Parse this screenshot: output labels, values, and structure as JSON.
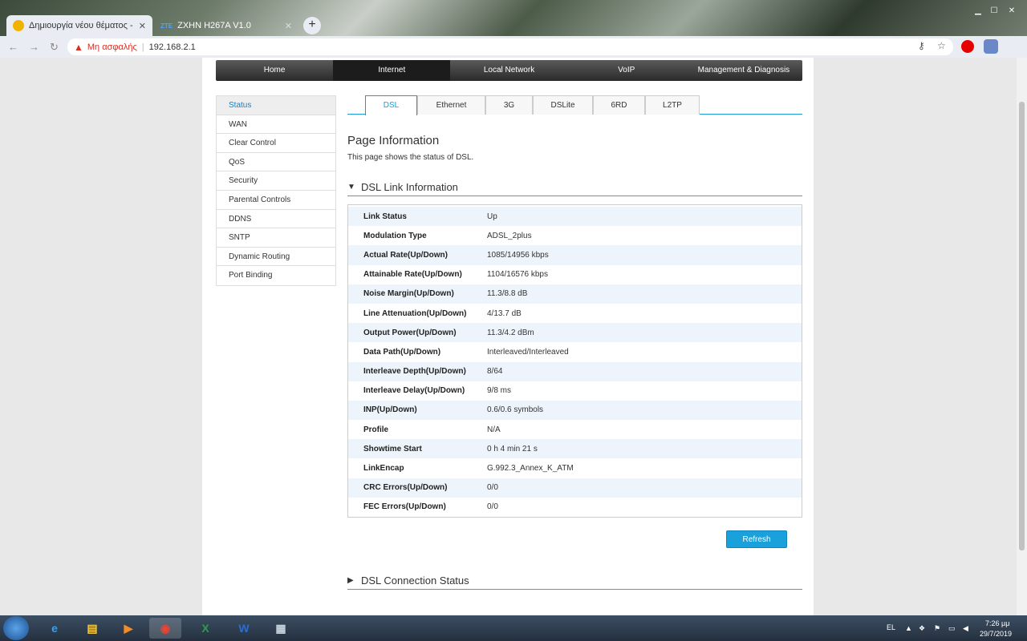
{
  "browser": {
    "tabs": [
      {
        "title": "Δημιουργία νέου θέματος - Inso",
        "active": true,
        "favicon": "forum-favicon"
      },
      {
        "title": "ZXHN H267A V1.0",
        "active": false,
        "favicon": "zte-favicon",
        "favicon_text": "ZTE"
      }
    ],
    "new_tab": "+",
    "security_label": "Μη ασφαλής",
    "url": "192.168.2.1",
    "url_separator": "|"
  },
  "topnav": {
    "items": [
      "Home",
      "Internet",
      "Local Network",
      "VoIP",
      "Management & Diagnosis"
    ],
    "active": "Internet"
  },
  "sidebar": {
    "items": [
      "Status",
      "WAN",
      "Clear Control",
      "QoS",
      "Security",
      "Parental Controls",
      "DDNS",
      "SNTP",
      "Dynamic Routing",
      "Port Binding"
    ],
    "active": "Status"
  },
  "subtabs": {
    "items": [
      "DSL",
      "Ethernet",
      "3G",
      "DSLite",
      "6RD",
      "L2TP"
    ],
    "active": "DSL"
  },
  "page": {
    "title": "Page Information",
    "description": "This page shows the status of DSL."
  },
  "dsl_link": {
    "heading": "DSL Link Information",
    "expanded": true,
    "rows": [
      {
        "label": "Link Status",
        "value": "Up"
      },
      {
        "label": "Modulation Type",
        "value": "ADSL_2plus"
      },
      {
        "label": "Actual Rate(Up/Down)",
        "value": "1085/14956 kbps"
      },
      {
        "label": "Attainable Rate(Up/Down)",
        "value": "1104/16576 kbps"
      },
      {
        "label": "Noise Margin(Up/Down)",
        "value": "11.3/8.8 dB"
      },
      {
        "label": "Line Attenuation(Up/Down)",
        "value": "4/13.7 dB"
      },
      {
        "label": "Output Power(Up/Down)",
        "value": "11.3/4.2 dBm"
      },
      {
        "label": "Data Path(Up/Down)",
        "value": "Interleaved/Interleaved"
      },
      {
        "label": "Interleave Depth(Up/Down)",
        "value": "8/64"
      },
      {
        "label": "Interleave Delay(Up/Down)",
        "value": "9/8 ms"
      },
      {
        "label": "INP(Up/Down)",
        "value": "0.6/0.6 symbols"
      },
      {
        "label": "Profile",
        "value": "N/A"
      },
      {
        "label": "Showtime Start",
        "value": "0 h 4 min 21 s"
      },
      {
        "label": "LinkEncap",
        "value": "G.992.3_Annex_K_ATM"
      },
      {
        "label": "CRC Errors(Up/Down)",
        "value": "0/0"
      },
      {
        "label": "FEC Errors(Up/Down)",
        "value": "0/0"
      }
    ],
    "refresh_label": "Refresh"
  },
  "dsl_connection": {
    "heading": "DSL Connection Status",
    "expanded": false
  },
  "taskbar": {
    "apps": [
      "internet-explorer-icon",
      "file-explorer-icon",
      "media-player-icon",
      "chrome-icon",
      "excel-icon",
      "word-icon",
      "calculator-icon"
    ],
    "language": "EL",
    "time": "7:26 μμ",
    "date": "29/7/2019"
  },
  "colors": {
    "accent": "#1a9ad6",
    "refresh_button": "#1aa0db",
    "nav_bar": "#2a2a2a",
    "row_alt": "#eef4fb",
    "insecure": "#d93025"
  }
}
